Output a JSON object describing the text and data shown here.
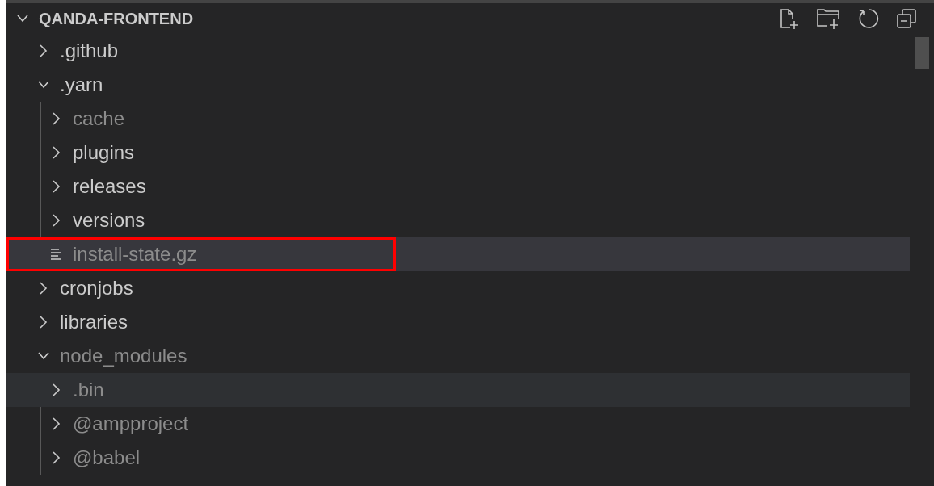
{
  "explorer": {
    "title": "QANDA-FRONTEND",
    "expanded": true
  },
  "tree": [
    {
      "name": ".github",
      "kind": "folder",
      "expanded": false,
      "ignored": false,
      "selected": false,
      "hovered": false
    },
    {
      "name": ".yarn",
      "kind": "folder",
      "expanded": true,
      "ignored": false,
      "selected": false,
      "hovered": false,
      "children": [
        {
          "name": "cache",
          "kind": "folder",
          "expanded": false,
          "ignored": true,
          "selected": false,
          "hovered": false
        },
        {
          "name": "plugins",
          "kind": "folder",
          "expanded": false,
          "ignored": false,
          "selected": false,
          "hovered": false
        },
        {
          "name": "releases",
          "kind": "folder",
          "expanded": false,
          "ignored": false,
          "selected": false,
          "hovered": false
        },
        {
          "name": "versions",
          "kind": "folder",
          "expanded": false,
          "ignored": false,
          "selected": false,
          "hovered": false
        },
        {
          "name": "install-state.gz",
          "kind": "file",
          "ignored": true,
          "selected": true,
          "hovered": false,
          "annotated": true
        }
      ]
    },
    {
      "name": "cronjobs",
      "kind": "folder",
      "expanded": false,
      "ignored": false,
      "selected": false,
      "hovered": false
    },
    {
      "name": "libraries",
      "kind": "folder",
      "expanded": false,
      "ignored": false,
      "selected": false,
      "hovered": false
    },
    {
      "name": "node_modules",
      "kind": "folder",
      "expanded": true,
      "ignored": true,
      "selected": false,
      "hovered": false,
      "children": [
        {
          "name": ".bin",
          "kind": "folder",
          "expanded": false,
          "ignored": true,
          "selected": false,
          "hovered": true
        },
        {
          "name": "@ampproject",
          "kind": "folder",
          "expanded": false,
          "ignored": true,
          "selected": false,
          "hovered": false
        },
        {
          "name": "@babel",
          "kind": "folder",
          "expanded": false,
          "ignored": true,
          "selected": false,
          "hovered": false
        }
      ]
    }
  ]
}
